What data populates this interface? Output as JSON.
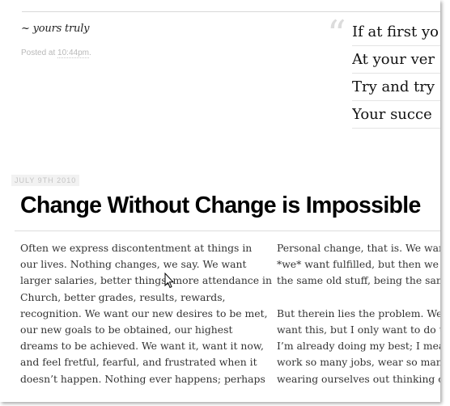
{
  "header": {
    "signature": "~ yours truly",
    "posted_prefix": "Posted at",
    "posted_time": "10:44pm",
    "posted_suffix": "."
  },
  "quote": {
    "mark": "“",
    "lines": [
      "If at first yo",
      "At your ver",
      "Try and try",
      "Your succe"
    ]
  },
  "post": {
    "date": "JULY 9TH 2010",
    "title": "Change Without Change is Impossible",
    "left_column": [
      "Often we express discontentment at things in",
      "our lives. Nothing changes, we say. We want",
      "larger salaries, better things, more attendance in",
      "Church, better grades, results, rewards,",
      "recognition. We want our new desires to be met,",
      "our new goals to be obtained, our highest",
      "dreams to be achieved. We want it, want it now,",
      "and feel fretful, fearful, and frustrated when it",
      "doesn’t happen. Nothing ever happens; perhaps"
    ],
    "right_column_top": [
      "Personal change, that is. We wan",
      "*we* want fulfilled, but then we",
      "the same old stuff, being the sam"
    ],
    "right_column_bottom": [
      "But therein lies the problem. We",
      "want this, but I only want to do t",
      "I’m already doing my best; I mean",
      "work so many jobs, wear so man",
      "wearing ourselves out thinking o"
    ]
  }
}
